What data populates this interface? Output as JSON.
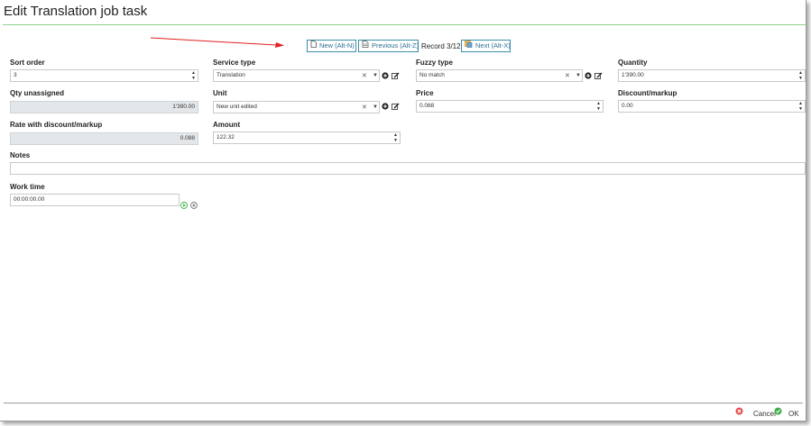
{
  "window": {
    "title": "Edit Translation job task"
  },
  "nav": {
    "new_label": "New (Alt-N)",
    "previous_label": "Previous (Alt-Z)",
    "record": "Record 3/12",
    "next_label": "Next (Alt-X)"
  },
  "fields": {
    "sort_order": {
      "label": "Sort order",
      "value": "3"
    },
    "service_type": {
      "label": "Service type",
      "value": "Translation"
    },
    "fuzzy_type": {
      "label": "Fuzzy type",
      "value": "No match"
    },
    "quantity": {
      "label": "Quantity",
      "value": "1'390.00"
    },
    "qty_unassigned": {
      "label": "Qty unassigned",
      "value": "1'390.00"
    },
    "unit": {
      "label": "Unit",
      "value": "New unit edited"
    },
    "price": {
      "label": "Price",
      "value": "0.088"
    },
    "discount": {
      "label": "Discount/markup",
      "value": "0.00"
    },
    "rate_with_discount": {
      "label": "Rate with discount/markup",
      "value": "0.088"
    },
    "amount": {
      "label": "Amount",
      "value": "122.32"
    },
    "notes": {
      "label": "Notes",
      "value": ""
    },
    "work_time": {
      "label": "Work time",
      "value": "00:00:00.00"
    }
  },
  "footer": {
    "cancel_label": "Cancel",
    "ok_label": "OK"
  },
  "colors": {
    "accent": "#2b6f93",
    "rule_green": "#8fd08f",
    "arrow": "#e02020",
    "cancel_red": "#e34b4b",
    "ok_green": "#3cae4a"
  }
}
